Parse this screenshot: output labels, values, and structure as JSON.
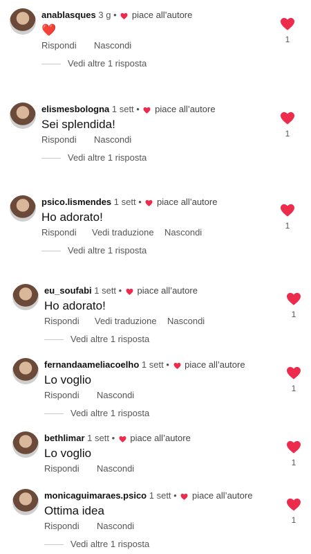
{
  "colors": {
    "heart": "#ed2b4d",
    "muted": "#555555"
  },
  "comments": [
    {
      "user": "anablasques",
      "time": "3 g",
      "author_like": "piace all’autore",
      "text": "❤️",
      "actions": [
        "Rispondi",
        "Nascondi"
      ],
      "replies": "Vedi altre 1 risposta",
      "likes": "1"
    },
    {
      "user": "elismesbologna",
      "time": "1 sett",
      "author_like": "piace all’autore",
      "text": "Sei splendida!",
      "actions": [
        "Rispondi",
        "Nascondi"
      ],
      "replies": "Vedi altre 1 risposta",
      "likes": "1"
    },
    {
      "user": "psico.lismendes",
      "time": "1 sett",
      "author_like": "piace all’autore",
      "text": "Ho adorato!",
      "actions": [
        "Rispondi",
        "Vedi traduzione",
        "Nascondi"
      ],
      "replies": "Vedi altre 1 risposta",
      "likes": "1"
    },
    {
      "user": "eu_soufabi",
      "time": "1 sett",
      "author_like": "piace all’autore",
      "text": "Ho adorato!",
      "actions": [
        "Rispondi",
        "Vedi traduzione",
        "Nascondi"
      ],
      "replies": "Vedi altre 1 risposta",
      "likes": "1"
    },
    {
      "user": "fernandaameliacoelho",
      "time": "1 sett",
      "author_like": "piace all’autore",
      "text": "Lo voglio",
      "actions": [
        "Rispondi",
        "Nascondi"
      ],
      "replies": "Vedi altre 1 risposta",
      "likes": "1"
    },
    {
      "user": "bethlimar",
      "time": "1 sett",
      "author_like": "piace all’autore",
      "text": "Lo voglio",
      "actions": [
        "Rispondi",
        "Nascondi"
      ],
      "replies": null,
      "likes": "1"
    },
    {
      "user": "monicaguimaraes.psico",
      "time": "1 sett",
      "author_like": "piace all’autore",
      "text": "Ottima idea",
      "actions": [
        "Rispondi",
        "Nascondi"
      ],
      "replies": "Vedi altre 1 risposta",
      "likes": "1"
    }
  ]
}
